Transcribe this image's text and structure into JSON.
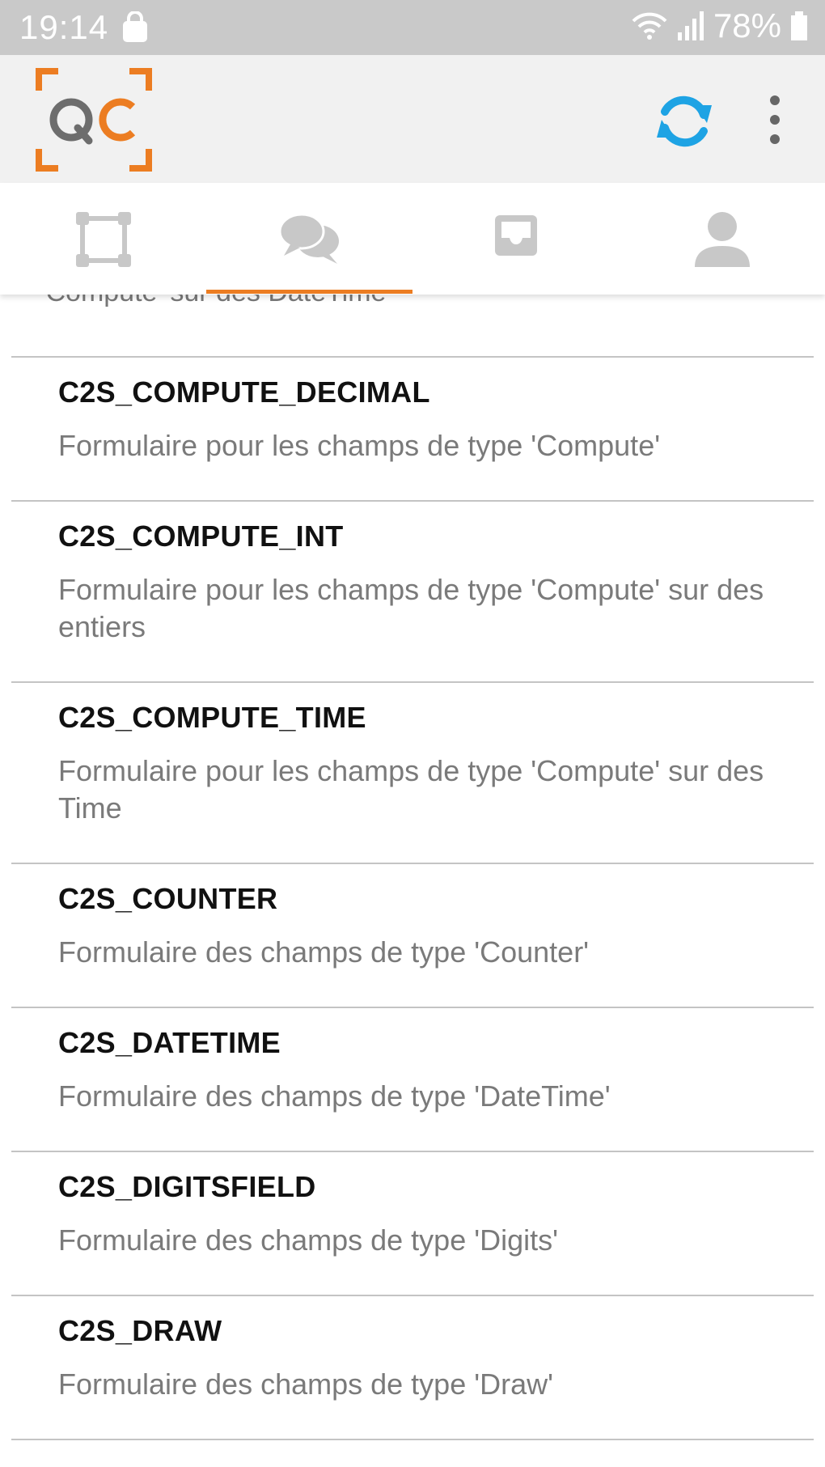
{
  "status_bar": {
    "time": "19:14",
    "battery": "78%"
  },
  "app_bar": {
    "logo_text": "QC",
    "accent_color": "#ec7d22",
    "refresh_color": "#1ea3e4"
  },
  "tabs": [
    {
      "icon": "frame-icon",
      "selected": false
    },
    {
      "icon": "chat-icon",
      "selected": true
    },
    {
      "icon": "inbox-icon",
      "selected": false
    },
    {
      "icon": "user-icon",
      "selected": false
    }
  ],
  "list": {
    "partial_top_desc": "'Compute' sur des DateTime",
    "items": [
      {
        "title": "C2S_COMPUTE_DECIMAL",
        "desc": "Formulaire pour les champs de type 'Compute'"
      },
      {
        "title": "C2S_COMPUTE_INT",
        "desc": "Formulaire pour les champs de type 'Compute' sur des entiers"
      },
      {
        "title": "C2S_COMPUTE_TIME",
        "desc": "Formulaire pour les champs de type 'Compute' sur des Time"
      },
      {
        "title": "C2S_COUNTER",
        "desc": "Formulaire des champs de type 'Counter'"
      },
      {
        "title": "C2S_DATETIME",
        "desc": "Formulaire des champs de type 'DateTime'"
      },
      {
        "title": "C2S_DIGITSFIELD",
        "desc": "Formulaire des champs de type 'Digits'"
      },
      {
        "title": "C2S_DRAW",
        "desc": "Formulaire des champs de type 'Draw'"
      }
    ]
  }
}
